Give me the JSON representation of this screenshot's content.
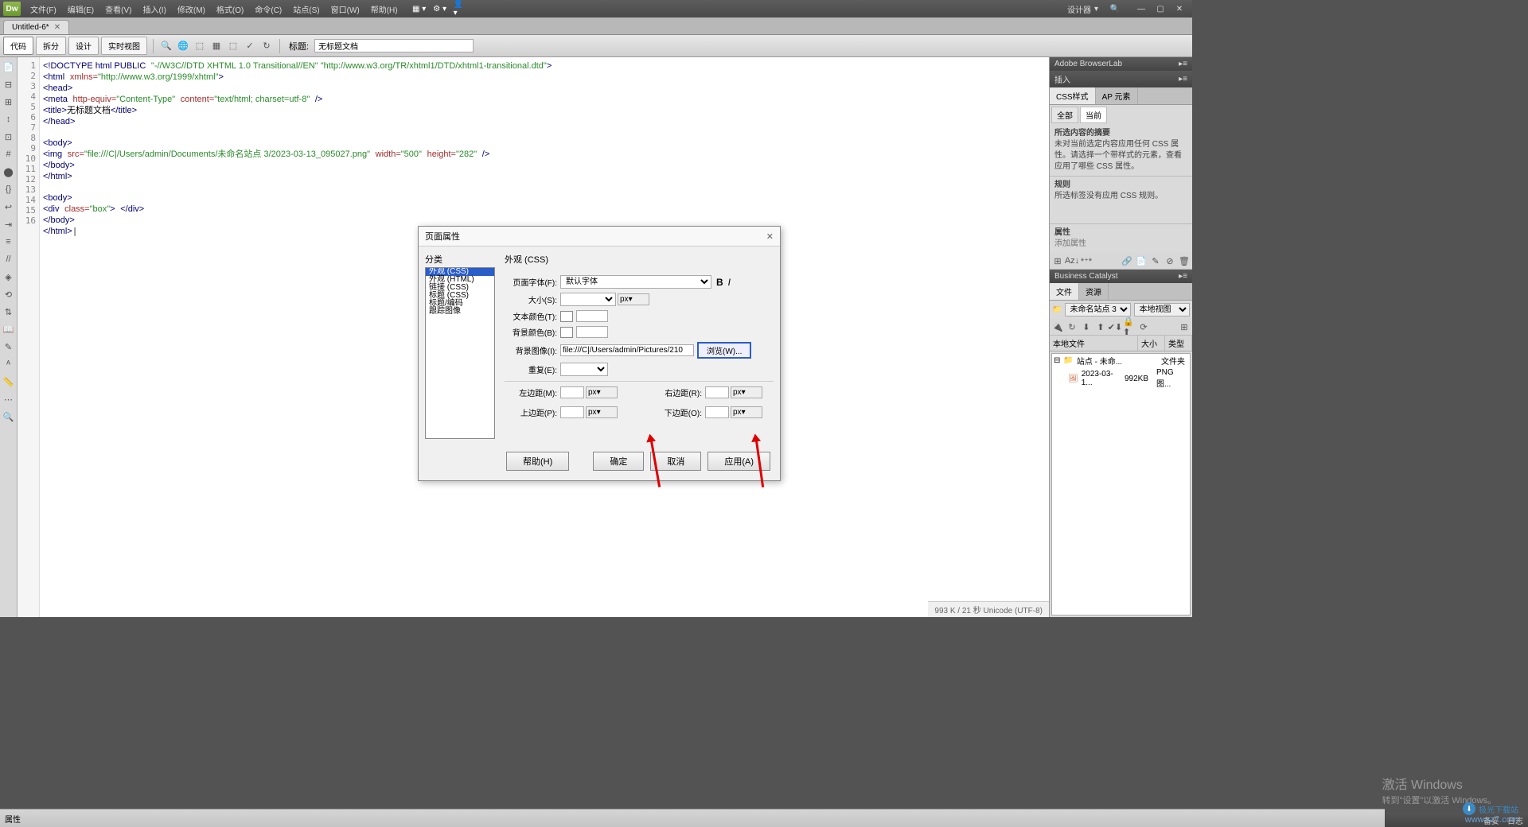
{
  "menu": {
    "items": [
      "文件(F)",
      "编辑(E)",
      "查看(V)",
      "插入(I)",
      "修改(M)",
      "格式(O)",
      "命令(C)",
      "站点(S)",
      "窗口(W)",
      "帮助(H)"
    ],
    "designer_label": "设计器"
  },
  "document": {
    "tab_title": "Untitled-6*",
    "title_label": "标题:",
    "title_value": "无标题文档"
  },
  "view_buttons": [
    "代码",
    "拆分",
    "设计",
    "实时视图"
  ],
  "code": {
    "lines": [
      {
        "n": 1,
        "html": "<span class='tag'>&lt;!DOCTYPE html PUBLIC</span> <span class='str'>\"-//W3C//DTD XHTML 1.0 Transitional//EN\" \"http://www.w3.org/TR/xhtml1/DTD/xhtml1-transitional.dtd\"</span><span class='tag'>&gt;</span>"
      },
      {
        "n": 2,
        "html": "<span class='tag'>&lt;html</span> <span class='attr'>xmlns=</span><span class='str'>\"http://www.w3.org/1999/xhtml\"</span><span class='tag'>&gt;</span>"
      },
      {
        "n": 3,
        "html": "<span class='tag'>&lt;head&gt;</span>"
      },
      {
        "n": 4,
        "html": "<span class='tag'>&lt;meta</span> <span class='attr'>http-equiv=</span><span class='str'>\"Content-Type\"</span> <span class='attr'>content=</span><span class='str'>\"text/html; charset=utf-8\"</span> <span class='tag'>/&gt;</span>"
      },
      {
        "n": 5,
        "html": "<span class='tag'>&lt;title&gt;</span><span class='txt'>无标题文档</span><span class='tag'>&lt;/title&gt;</span>"
      },
      {
        "n": 6,
        "html": "<span class='tag'>&lt;/head&gt;</span>"
      },
      {
        "n": 7,
        "html": ""
      },
      {
        "n": 8,
        "html": "<span class='tag'>&lt;body&gt;</span>"
      },
      {
        "n": 9,
        "html": "<span class='tag'>&lt;img</span> <span class='attr'>src=</span><span class='str'>\"file:///C|/Users/admin/Documents/未命名站点 3/2023-03-13_095027.png\"</span> <span class='attr'>width=</span><span class='str'>\"500\"</span> <span class='attr'>height=</span><span class='str'>\"282\"</span> <span class='tag'>/&gt;</span>"
      },
      {
        "n": 10,
        "html": "<span class='tag'>&lt;/body&gt;</span>"
      },
      {
        "n": 11,
        "html": "<span class='tag'>&lt;/html&gt;</span>"
      },
      {
        "n": 12,
        "html": ""
      },
      {
        "n": 13,
        "html": "<span class='tag'>&lt;body&gt;</span>"
      },
      {
        "n": 14,
        "html": "<span class='tag'>&lt;div</span> <span class='attr'>class=</span><span class='str'>\"box\"</span><span class='tag'>&gt;</span> <span class='tag'>&lt;/div&gt;</span>"
      },
      {
        "n": 15,
        "html": "<span class='tag'>&lt;/body&gt;</span>"
      },
      {
        "n": 16,
        "html": "<span class='tag'>&lt;/html&gt;</span>|"
      }
    ]
  },
  "panels": {
    "browserlab": "Adobe BrowserLab",
    "insert": "插入",
    "css_tabs": [
      "CSS样式",
      "AP 元素"
    ],
    "all": "全部",
    "current": "当前",
    "selection_summary_title": "所选内容的摘要",
    "selection_summary_text": "未对当前选定内容应用任何 CSS 属性。请选择一个带样式的元素，查看应用了哪些 CSS 属性。",
    "rules_title": "规则",
    "rules_text": "所选标签没有应用 CSS 规则。",
    "properties_title": "属性",
    "add_property": "添加属性",
    "business_catalyst": "Business Catalyst",
    "file_tabs": [
      "文件",
      "资源"
    ],
    "site_name": "未命名站点 3",
    "local_view": "本地视图",
    "local_files": "本地文件",
    "size_col": "大小",
    "type_col": "类型",
    "site_root": "站点 - 未命...",
    "site_root_type": "文件夹",
    "file_item": "2023-03-1...",
    "file_size": "992KB",
    "file_type": "PNG 图...",
    "ready": "备妥",
    "log": "日志"
  },
  "status_bar": "993 K / 21 秒 Unicode (UTF-8)",
  "properties_label": "属性",
  "dialog": {
    "title": "页面属性",
    "category_label": "分类",
    "categories": [
      "外观 (CSS)",
      "外观 (HTML)",
      "链接 (CSS)",
      "标题 (CSS)",
      "标题/编码",
      "跟踪图像"
    ],
    "panel_title": "外观 (CSS)",
    "font_label": "页面字体(F):",
    "font_value": "默认字体",
    "size_label": "大小(S):",
    "size_unit": "px",
    "text_color_label": "文本颜色(T):",
    "bg_color_label": "背景颜色(B):",
    "bg_image_label": "背景图像(I):",
    "bg_image_value": "file:///C|/Users/admin/Pictures/210",
    "browse_label": "浏览(W)...",
    "repeat_label": "重复(E):",
    "left_margin": "左边距(M):",
    "right_margin": "右边距(R):",
    "top_margin": "上边距(P):",
    "bottom_margin": "下边距(O):",
    "margin_unit": "px",
    "help_btn": "帮助(H)",
    "ok_btn": "确定",
    "cancel_btn": "取消",
    "apply_btn": "应用(A)"
  },
  "watermark": {
    "activate": "激活 Windows",
    "activate_sub": "转到\"设置\"以激活 Windows。",
    "brand": "极光下载站",
    "url": "www.xz7.com"
  }
}
